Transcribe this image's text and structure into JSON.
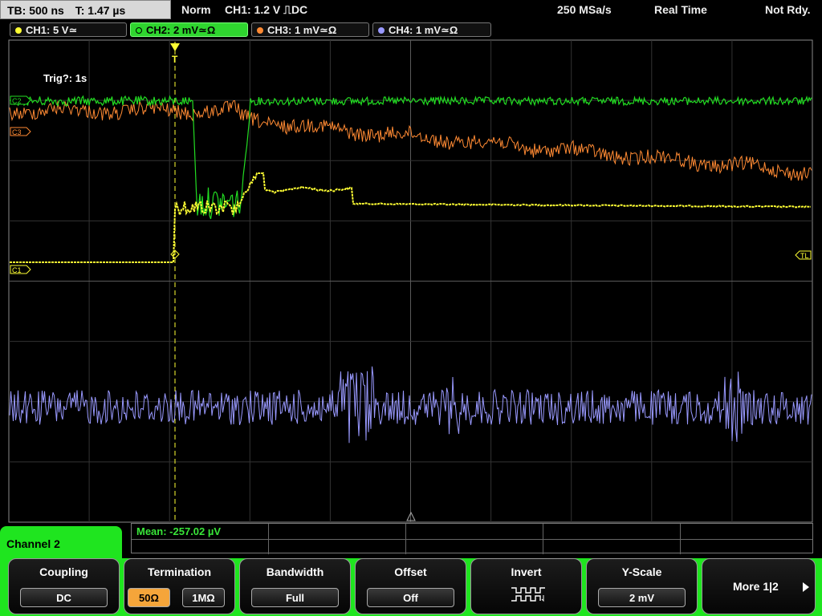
{
  "header": {
    "timebase": "TB: 500 ns",
    "trigger_time": "T: 1.47 µs",
    "mode": "Norm",
    "trigger": "CH1: 1.2 V ⎍DC",
    "sample_rate": "250 MSa/s",
    "acquisition": "Real Time",
    "status": "Not Rdy."
  },
  "channels": [
    {
      "label": "CH1: 5 V≃",
      "color": "#ffff33",
      "active": false
    },
    {
      "label": "CH2: 2 mV≃Ω",
      "color": "#22dd22",
      "active": true
    },
    {
      "label": "CH3: 1 mV≃Ω",
      "color": "#ff8a33",
      "active": false
    },
    {
      "label": "CH4: 1 mV≃Ω",
      "color": "#9999ff",
      "active": false
    }
  ],
  "screen": {
    "trig_info": "Trig?: 1s",
    "marker_c1": "C1",
    "marker_c2": "C2",
    "marker_c3": "C3",
    "marker_tl": "TL"
  },
  "measurement": {
    "mean": "Mean: -257.02 µV"
  },
  "menu": {
    "title": "Channel 2",
    "coupling": {
      "label": "Coupling",
      "value": "DC"
    },
    "termination": {
      "label": "Termination",
      "value_a": "50Ω",
      "value_b": "1MΩ"
    },
    "bandwidth": {
      "label": "Bandwidth",
      "value": "Full"
    },
    "offset": {
      "label": "Offset",
      "value": "Off"
    },
    "invert": {
      "label": "Invert",
      "icon": "invert-waveform-icon"
    },
    "yscale": {
      "label": "Y-Scale",
      "value": "2 mV"
    },
    "more": {
      "label": "More 1|2"
    }
  }
}
